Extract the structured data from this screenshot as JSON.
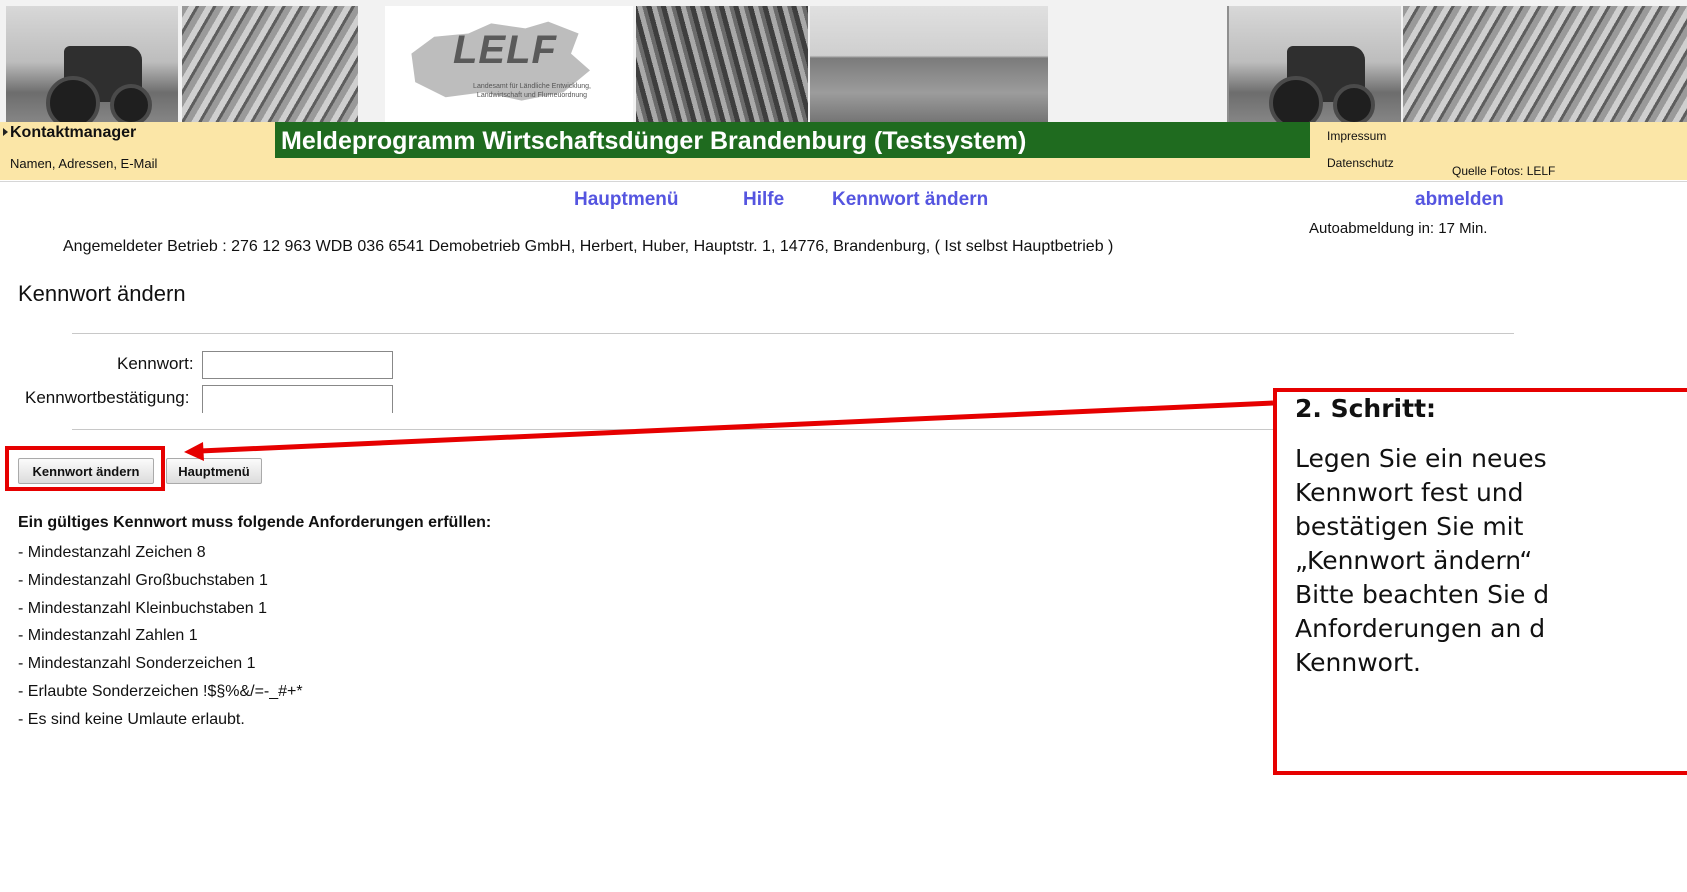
{
  "banner": {
    "logo_title": "LELF",
    "logo_subtitle_line1": "Landesamt für Ländliche Entwicklung,",
    "logo_subtitle_line2": "Landwirtschaft und Flurneuordnung"
  },
  "header": {
    "contact_title": "Kontaktmanager",
    "contact_subtitle": "Namen, Adressen, E-Mail",
    "app_title": "Meldeprogramm Wirtschaftsdünger Brandenburg (Testsystem)",
    "impressum": "Impressum",
    "datenschutz": "Datenschutz",
    "photo_credit": "Quelle Fotos: LELF"
  },
  "nav": {
    "hauptmenu": "Hauptmenü",
    "hilfe": "Hilfe",
    "kennwort_aendern": "Kennwort ändern",
    "abmelden": "abmelden",
    "auto_logout": "Autoabmeldung in: 17 Min."
  },
  "company_line": "Angemeldeter Betrieb : 276 12 963 WDB 036 6541 Demobetrieb GmbH, Herbert, Huber, Hauptstr. 1, 14776, Brandenburg, ( Ist selbst Hauptbetrieb )",
  "page_heading": "Kennwort ändern",
  "form": {
    "password_label": "Kennwort:",
    "password_value": "",
    "confirm_label": "Kennwortbestätigung:",
    "confirm_value": ""
  },
  "buttons": {
    "change_password": "Kennwort ändern",
    "main_menu": "Hauptmenü"
  },
  "requirements": {
    "title": "Ein gültiges Kennwort muss folgende Anforderungen erfüllen:",
    "items": [
      "- Mindestanzahl Zeichen 8",
      "- Mindestanzahl Großbuchstaben 1",
      "- Mindestanzahl Kleinbuchstaben 1",
      "- Mindestanzahl Zahlen 1",
      "- Mindestanzahl Sonderzeichen 1",
      "- Erlaubte Sonderzeichen !$§%&/=-_#+*",
      "- Es sind keine Umlaute erlaubt."
    ]
  },
  "callout": {
    "title": "2. Schritt:",
    "lines": [
      "Legen Sie ein neues",
      "Kennwort fest und",
      "bestätigen Sie mit",
      "„Kennwort ändern“",
      "Bitte beachten Sie d",
      "Anforderungen an d",
      "Kennwort."
    ]
  },
  "colors": {
    "title_bar": "#1f6b1f",
    "header_bg": "#fbe6a7",
    "nav_link": "#5555e0",
    "highlight": "#e60000"
  }
}
